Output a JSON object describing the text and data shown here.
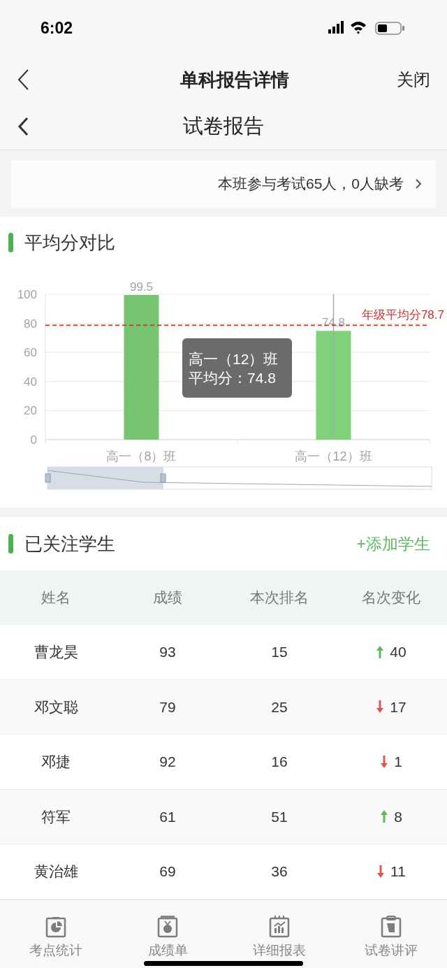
{
  "status_bar": {
    "time": "6:02"
  },
  "nav_outer": {
    "title": "单科报告详情",
    "close": "关闭"
  },
  "nav_inner": {
    "title": "试卷报告"
  },
  "summary": {
    "text": "本班参与考试65人，0人缺考"
  },
  "average_section": {
    "title": "平均分对比",
    "chart_data": {
      "type": "bar",
      "categories": [
        "高一（8）班",
        "高一（12）班"
      ],
      "series": [
        {
          "color": "#77c472",
          "values": [
            99.5,
            74.8
          ]
        }
      ],
      "ylim": [
        0,
        100
      ],
      "yticks": [
        0,
        20,
        40,
        60,
        80,
        100
      ],
      "grid": true,
      "data_labels": true,
      "ref_lines": [
        {
          "axis": "y",
          "value": 78.7,
          "label": "年级平均分78.7",
          "color": "#c9332b"
        },
        {
          "axis": "x",
          "value": "高一（12）班",
          "color": "#aaaaaa"
        }
      ]
    },
    "tooltip": {
      "title": "高一（12）班",
      "line": "平均分：74.8"
    }
  },
  "followed_section": {
    "title": "已关注学生",
    "add_button": "+添加学生"
  },
  "table": {
    "columns": [
      "姓名",
      "成绩",
      "本次排名",
      "名次变化"
    ],
    "rows": [
      {
        "name": "曹龙昊",
        "score": "93",
        "rank": "15",
        "change": "40",
        "kind": "up"
      },
      {
        "name": "邓文聪",
        "score": "79",
        "rank": "25",
        "change": "17",
        "kind": "down"
      },
      {
        "name": "邓捷",
        "score": "92",
        "rank": "16",
        "change": "1",
        "kind": "down"
      },
      {
        "name": "符军",
        "score": "61",
        "rank": "51",
        "change": "8",
        "kind": "up"
      },
      {
        "name": "黄治雄",
        "score": "69",
        "rank": "36",
        "change": "11",
        "kind": "down"
      }
    ]
  },
  "tab_bar": [
    {
      "label": "考点统计",
      "kind": "pie"
    },
    {
      "label": "成绩单",
      "kind": "medal"
    },
    {
      "label": "详细报表",
      "kind": "chart"
    },
    {
      "label": "试卷讲评",
      "kind": "scroll"
    }
  ]
}
